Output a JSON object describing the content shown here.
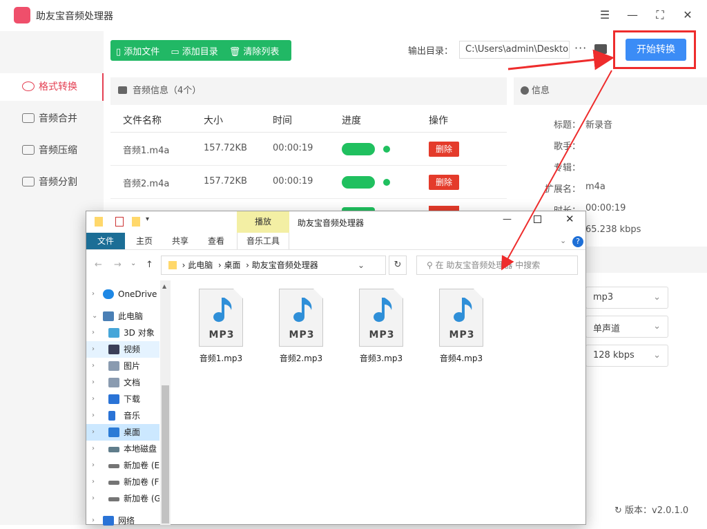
{
  "app": {
    "title": "助友宝音频处理器",
    "logo_color": "#ef4f6b"
  },
  "window_controls": [
    "☰",
    "—",
    "⛶",
    "✕"
  ],
  "sidebar": {
    "items": [
      {
        "label": "格式转换",
        "active": true
      },
      {
        "label": "音频合并",
        "active": false
      },
      {
        "label": "音频压缩",
        "active": false
      },
      {
        "label": "音频分割",
        "active": false
      }
    ]
  },
  "toolbar": {
    "add_file": "添加文件",
    "add_dir": "添加目录",
    "clear_list": "清除列表",
    "output_label": "输出目录：",
    "output_path": "C:\\Users\\admin\\Desktop",
    "more": "···",
    "start": "开始转换"
  },
  "file_list": {
    "header": "音频信息（4个）",
    "columns": [
      "文件名称",
      "大小",
      "时间",
      "进度",
      "操作"
    ],
    "rows": [
      {
        "name": "音频1.m4a",
        "size": "157.72KB",
        "time": "00:00:19",
        "progress": 1.0,
        "action": "删除"
      },
      {
        "name": "音频2.m4a",
        "size": "157.72KB",
        "time": "00:00:19",
        "progress": 1.0,
        "action": "删除"
      }
    ]
  },
  "info": {
    "header": "信息",
    "labels": [
      "标题：",
      "歌手：",
      "专辑：",
      "扩展名：",
      "时长："
    ],
    "title_value": "新录音",
    "ext_value": "m4a",
    "duration_value": "00:00:19",
    "bitrate_value": "65.238 kbps",
    "selects": [
      "mp3",
      "单声道",
      "128 kbps"
    ]
  },
  "version": "版本：v2.0.1.0",
  "explorer": {
    "title": "助友宝音频处理器",
    "context_tab": "播放",
    "tabs": [
      "文件",
      "主页",
      "共享",
      "查看",
      "音乐工具"
    ],
    "address": [
      "此电脑",
      "桌面",
      "助友宝音频处理器"
    ],
    "search_placeholder": "在 助友宝音频处理器 中搜索",
    "nav": [
      {
        "label": "OneDrive",
        "color": "#1e88e5"
      },
      {
        "label": "此电脑",
        "color": "#4a7fb5"
      },
      {
        "label": "3D 对象",
        "color": "#46a6d9"
      },
      {
        "label": "视频",
        "color": "#3b3f58"
      },
      {
        "label": "图片",
        "color": "#8a9bb0"
      },
      {
        "label": "文档",
        "color": "#8a9bb0"
      },
      {
        "label": "下载",
        "color": "#2a73d6"
      },
      {
        "label": "音乐",
        "color": "#2a73d6"
      },
      {
        "label": "桌面",
        "color": "#2b7bd6"
      },
      {
        "label": "本地磁盘",
        "color": "#607d8b"
      },
      {
        "label": "新加卷 (E:",
        "color": "#757575"
      },
      {
        "label": "新加卷 (F:",
        "color": "#757575"
      },
      {
        "label": "新加卷 (G",
        "color": "#757575"
      },
      {
        "label": "网络",
        "color": "#2a73d6"
      }
    ],
    "files": [
      {
        "name": "音频1.mp3",
        "type_label": "MP3"
      },
      {
        "name": "音频2.mp3",
        "type_label": "MP3"
      },
      {
        "name": "音频3.mp3",
        "type_label": "MP3"
      },
      {
        "name": "音频4.mp3",
        "type_label": "MP3"
      }
    ]
  },
  "colors": {
    "green": "#21b865",
    "blue": "#3b8cf6",
    "red": "#e43b2b",
    "annotation": "#ee2c2c"
  }
}
